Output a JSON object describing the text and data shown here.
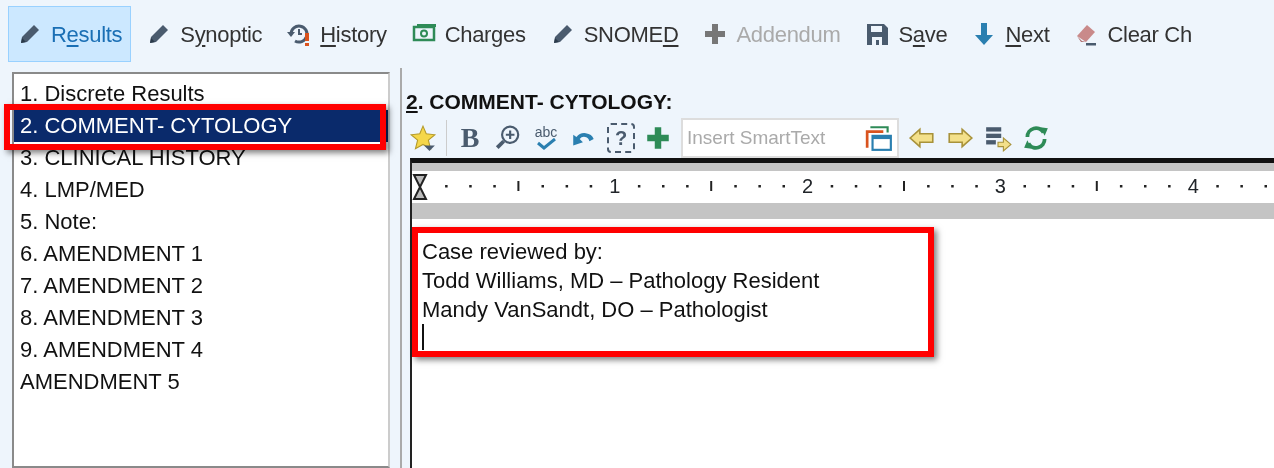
{
  "toolbar": [
    {
      "kind": "pencil",
      "pre": "R",
      "key": "e",
      "post": "sults",
      "selected": true,
      "disabled": false
    },
    {
      "kind": "pencil",
      "pre": "S",
      "key": "y",
      "post": "noptic",
      "selected": false,
      "disabled": false
    },
    {
      "kind": "history",
      "key": "H",
      "post": "istory",
      "selected": false,
      "disabled": false
    },
    {
      "kind": "charges",
      "pre": "Charges",
      "selected": false,
      "disabled": false
    },
    {
      "kind": "pencil",
      "pre": "SNOME",
      "key": "D",
      "selected": false,
      "disabled": false
    },
    {
      "kind": "plus",
      "pre": "Addendum",
      "selected": false,
      "disabled": true
    },
    {
      "kind": "save",
      "pre": "S",
      "key": "a",
      "post": "ve",
      "selected": false,
      "disabled": false
    },
    {
      "kind": "down",
      "key": "N",
      "post": "ext",
      "selected": false,
      "disabled": false
    },
    {
      "kind": "eraser",
      "pre": "Clear Ch",
      "selected": false,
      "disabled": false
    }
  ],
  "sections": [
    {
      "label": "1. Discrete Results",
      "selected": false,
      "callout": false
    },
    {
      "label": "2. COMMENT- CYTOLOGY",
      "selected": true,
      "callout": true
    },
    {
      "label": "3. CLINICAL HISTORY",
      "selected": false,
      "callout": false
    },
    {
      "label": "4. LMP/MED",
      "selected": false,
      "callout": false
    },
    {
      "label": "5. Note:",
      "selected": false,
      "callout": false
    },
    {
      "label": "6. AMENDMENT 1",
      "selected": false,
      "callout": false
    },
    {
      "label": "7. AMENDMENT 2",
      "selected": false,
      "callout": false
    },
    {
      "label": "8. AMENDMENT 3",
      "selected": false,
      "callout": false
    },
    {
      "label": "9. AMENDMENT 4",
      "selected": false,
      "callout": false
    },
    {
      "label": "AMENDMENT 5",
      "selected": false,
      "callout": false
    }
  ],
  "heading": {
    "key": "2",
    "rest": ". COMMENT- CYTOLOGY:"
  },
  "editor_tools": [
    {
      "kind": "star"
    },
    {
      "kind": "separator"
    },
    {
      "kind": "bold",
      "text": "B"
    },
    {
      "kind": "zoom"
    },
    {
      "kind": "spell",
      "text": "abc"
    },
    {
      "kind": "undo"
    },
    {
      "kind": "help",
      "text": "?"
    },
    {
      "kind": "plus"
    },
    {
      "kind": "smarttext",
      "placeholder": "Insert SmartText"
    },
    {
      "kind": "left"
    },
    {
      "kind": "right"
    },
    {
      "kind": "list"
    },
    {
      "kind": "refresh"
    }
  ],
  "ruler": {
    "labels": [
      "1",
      "2",
      "3",
      "4"
    ]
  },
  "editor": {
    "callout": true,
    "lines": [
      "Case reviewed by:",
      "Todd Williams, MD – Pathology Resident",
      "Mandy VanSandt, DO – Pathologist"
    ],
    "cursor": true
  }
}
